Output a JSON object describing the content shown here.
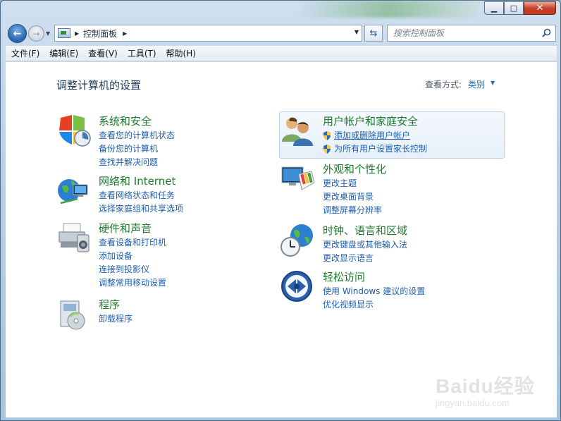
{
  "window": {
    "controls": {
      "minimize": "▁",
      "maximize": "□",
      "close": "✕"
    }
  },
  "address": {
    "breadcrumb": [
      "控制面板"
    ],
    "search_placeholder": "搜索控制面板"
  },
  "menubar": {
    "items": [
      "文件(F)",
      "编辑(E)",
      "查看(V)",
      "工具(T)",
      "帮助(H)"
    ]
  },
  "main": {
    "title": "调整计算机的设置",
    "view_by_label": "查看方式:",
    "view_by_value": "类别"
  },
  "categories": [
    {
      "id": "system-security",
      "title": "系统和安全",
      "icon": "shield-icon",
      "links": [
        "查看您的计算机状态",
        "备份您的计算机",
        "查找并解决问题"
      ]
    },
    {
      "id": "network",
      "title": "网络和 Internet",
      "icon": "network-globe-icon",
      "links": [
        "查看网络状态和任务",
        "选择家庭组和共享选项"
      ]
    },
    {
      "id": "hardware",
      "title": "硬件和声音",
      "icon": "printer-icon",
      "links": [
        "查看设备和打印机",
        "添加设备",
        "连接到投影仪",
        "调整常用移动设置"
      ]
    },
    {
      "id": "programs",
      "title": "程序",
      "icon": "programs-disc-icon",
      "links": [
        "卸载程序"
      ]
    },
    {
      "id": "user-accounts",
      "title": "用户帐户和家庭安全",
      "icon": "users-icon",
      "links": [
        "添加或删除用户帐户",
        "为所有用户设置家长控制"
      ]
    },
    {
      "id": "appearance",
      "title": "外观和个性化",
      "icon": "monitor-palette-icon",
      "links": [
        "更改主题",
        "更改桌面背景",
        "调整屏幕分辨率"
      ]
    },
    {
      "id": "clock-region",
      "title": "时钟、语言和区域",
      "icon": "clock-globe-icon",
      "links": [
        "更改键盘或其他输入法",
        "更改显示语言"
      ]
    },
    {
      "id": "ease-access",
      "title": "轻松访问",
      "icon": "ease-of-access-icon",
      "links": [
        "使用 Windows 建议的设置",
        "优化视频显示"
      ]
    }
  ],
  "watermark": {
    "brand": "Baidu经验",
    "url": "jingyan.baidu.com"
  }
}
